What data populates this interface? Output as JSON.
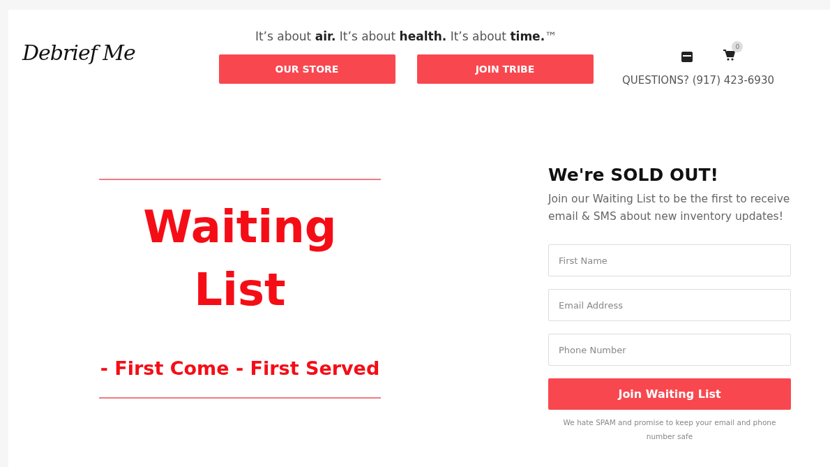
{
  "header": {
    "logo": "Debrief Me",
    "tagline": "It’s about **air.** It’s about **health.** It’s about **time.**™",
    "buttons": [
      "OUR STORE",
      "JOIN TRIBE"
    ],
    "cart_count": "0",
    "contact": "QUESTIONS? (917) 423-6930"
  },
  "hero": {
    "title_lines": [
      "Waiting",
      "List"
    ],
    "subtitle": "- First Come - First Served"
  },
  "signup": {
    "heading": "We're SOLD OUT!",
    "description": "Join our Waiting List to be the first to receive email & SMS about new inventory updates!",
    "fields": [
      {
        "placeholder": "First Name"
      },
      {
        "placeholder": "Email Address"
      },
      {
        "placeholder": "Phone Number"
      }
    ],
    "submit": "Join Waiting List",
    "note": "We hate SPAM and promise to keep your email and phone number safe"
  }
}
